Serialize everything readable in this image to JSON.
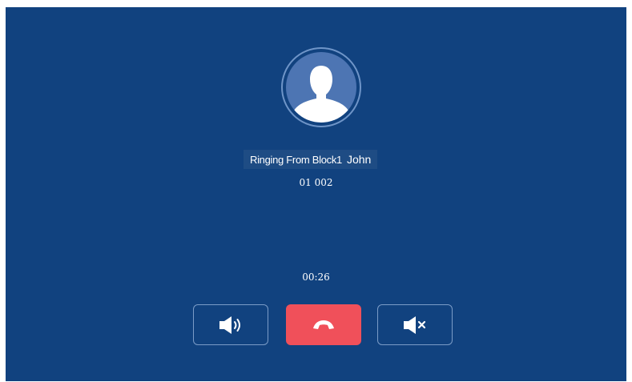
{
  "call": {
    "caller_prefix": "Ringing From Block1",
    "caller_name": "John",
    "caller_number": "01 002",
    "duration": "00:26"
  },
  "icons": {
    "avatar": "person-silhouette-icon",
    "speaker": "speaker-volume-icon",
    "hangup": "phone-hangup-icon",
    "mute": "speaker-mute-icon"
  },
  "colors": {
    "background": "#11427f",
    "hangup": "#f0505a",
    "avatar_fill": "#4d75b3",
    "button_border": "#7b9cc7",
    "label_background": "#1e4c84"
  }
}
